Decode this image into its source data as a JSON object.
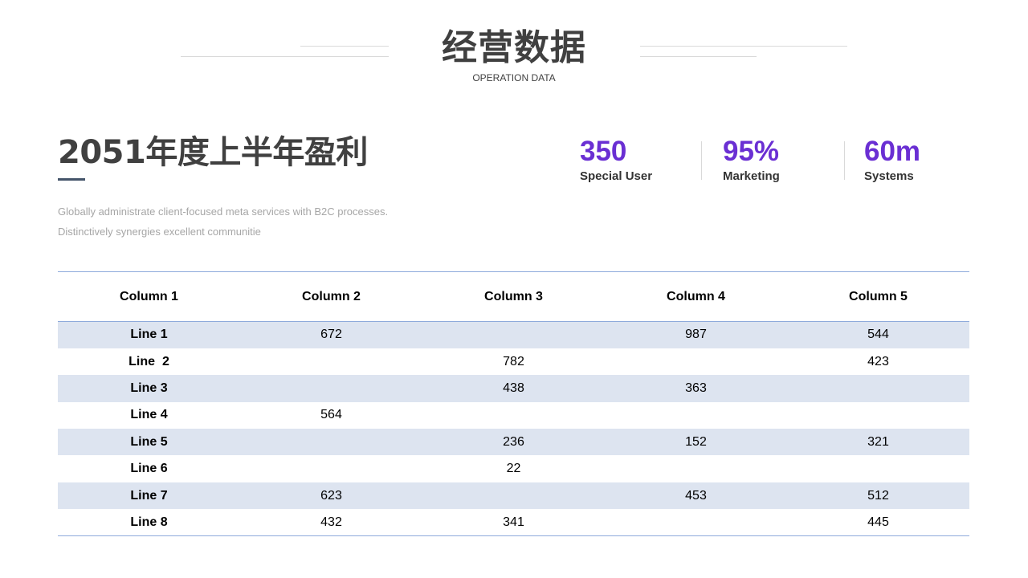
{
  "header": {
    "title": "经营数据",
    "subtitle": "OPERATION DATA"
  },
  "section": {
    "title": "2051年度上半年盈利",
    "description": [
      "Globally administrate client-focused meta services with B2C processes.",
      "Distinctively synergies excellent communitie"
    ]
  },
  "stats": [
    {
      "value": "350",
      "label": "Special User"
    },
    {
      "value": "95%",
      "label": "Marketing"
    },
    {
      "value": "60m",
      "label": "Systems"
    }
  ],
  "colors": {
    "accent": "#6a2fd3",
    "row_shade": "#dde4f0",
    "table_rule": "#8eaadb",
    "title_text": "#404040"
  },
  "table": {
    "columns": [
      "Column 1",
      "Column 2",
      "Column 3",
      "Column 4",
      "Column 5"
    ],
    "rows": [
      [
        "Line 1",
        "672",
        "",
        "987",
        "544"
      ],
      [
        "Line  2",
        "",
        "782",
        "",
        "423"
      ],
      [
        "Line 3",
        "",
        "438",
        "363",
        ""
      ],
      [
        "Line 4",
        "564",
        "",
        "",
        ""
      ],
      [
        "Line 5",
        "",
        "236",
        "152",
        "321"
      ],
      [
        "Line 6",
        "",
        "22",
        "",
        ""
      ],
      [
        "Line 7",
        "623",
        "",
        "453",
        "512"
      ],
      [
        "Line 8",
        "432",
        "341",
        "",
        "445"
      ]
    ]
  }
}
